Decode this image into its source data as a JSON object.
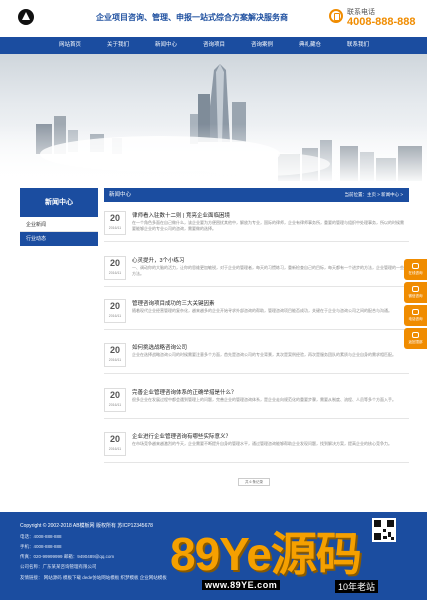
{
  "header": {
    "slogan": "企业项目咨询、管理、申报一站式综合方案解决服务商",
    "phone_label": "联系电话",
    "phone_number": "4008-888-888",
    "logo_icon": "logo-icon",
    "phone_icon": "phone-icon"
  },
  "nav": {
    "items": [
      "网站首页",
      "关于我们",
      "新闻中心",
      "咨询项目",
      "咨询案例",
      "典礼藏仓",
      "联系我们"
    ]
  },
  "sidebar": {
    "title": "新闻中心",
    "items": [
      "企业新闻",
      "行业动态"
    ]
  },
  "content": {
    "title": "新闻中心",
    "breadcrumb": "当前位置：主页 > 新闻中心 >"
  },
  "news": [
    {
      "day": "20",
      "ym": "2016/11",
      "title": "律师看入驻数十二则 | 竞亮企业面临困境",
      "summary": "在一个角色多面在自己做什么，该企业要为方便困扰其他中，解放为专业，国际的律师，企业有律师事务所，重要的管理与组织中处理事务，所以的时候需要能够企业的专业公司的咨询，需要做的选择。"
    },
    {
      "day": "20",
      "ym": "2016/11",
      "title": "心灵提升，3个小练习",
      "summary": "一、调动你的大脑的活力，让你的思维更加敏锐，对于企业的管理者，每天的习惯练习，重新检查自己的目标，每天都有一个进步的方法，企业管理的一些方法。"
    },
    {
      "day": "20",
      "ym": "2016/11",
      "title": "管理咨询项目成功的三大关键因素",
      "summary": "随着现代企业经营管理的复杂化，越来越多的企业开始寻求外部咨询的帮助，管理咨询项目能否成功，关键在于企业与咨询公司之间的配合与沟通。"
    },
    {
      "day": "20",
      "ym": "2016/11",
      "title": "如何挑选战略咨询公司",
      "summary": "企业在选择战略咨询公司的时候需要注意多个方面，首先是咨询公司的专业背景，其次是案例经验，再次是服务团队的素质与企业自身的需求相匹配。"
    },
    {
      "day": "20",
      "ym": "2016/11",
      "title": "完善企业管理咨询体系的正确举措是什么？",
      "summary": "很多企业在发展过程中都会遇到管理上的问题，完善企业的管理咨询体系，是企业走向规范化的重要步骤，需要从制度、流程、人员等多个方面入手。"
    },
    {
      "day": "20",
      "ym": "2016/11",
      "title": "企业进行企业管理咨询有哪些实际意义？",
      "summary": "在市场竞争越来越激烈的今天，企业需要不断提升自身的管理水平，通过管理咨询能够帮助企业发现问题，找到解决方案，提高企业的核心竞争力。"
    }
  ],
  "pager": "共 6 条记录",
  "footer": {
    "copyright": "Copyright © 2002-2018 AB模板网 版权所有  苏ICP12345678",
    "phone": "电话：4008-888-888",
    "mobile": "手机：4008-888-888",
    "contact": "传真：020-99999999  邮箱：9490489@qq.com",
    "company": "公司名称：广东某某咨询管理有限公司",
    "links": "友情链接：  网站源码   模板下载   dede仿站网站模板   织梦模板   企业网站模板"
  },
  "watermark": {
    "text": "89Ye源码",
    "url": "www.89YE.com",
    "badge": "10年老站"
  },
  "floating": {
    "items": [
      "在线咨询",
      "微信咨询",
      "电话咨询",
      "返回顶部"
    ]
  },
  "colors": {
    "primary": "#1b4da0",
    "accent": "#f08c00"
  }
}
